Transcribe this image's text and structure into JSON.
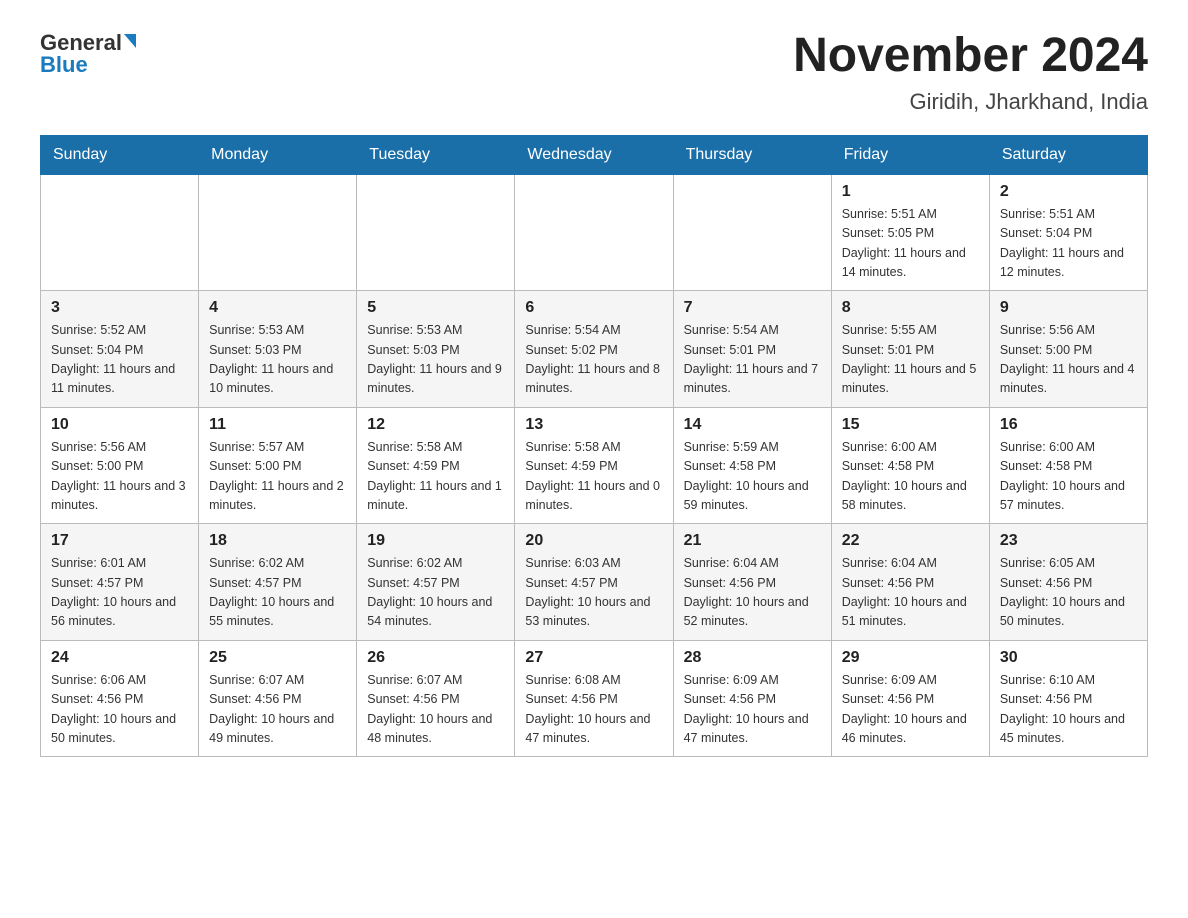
{
  "header": {
    "logo_general": "General",
    "logo_blue": "Blue",
    "title": "November 2024",
    "subtitle": "Giridih, Jharkhand, India"
  },
  "days_of_week": [
    "Sunday",
    "Monday",
    "Tuesday",
    "Wednesday",
    "Thursday",
    "Friday",
    "Saturday"
  ],
  "weeks": [
    [
      {
        "day": "",
        "sunrise": "",
        "sunset": "",
        "daylight": ""
      },
      {
        "day": "",
        "sunrise": "",
        "sunset": "",
        "daylight": ""
      },
      {
        "day": "",
        "sunrise": "",
        "sunset": "",
        "daylight": ""
      },
      {
        "day": "",
        "sunrise": "",
        "sunset": "",
        "daylight": ""
      },
      {
        "day": "",
        "sunrise": "",
        "sunset": "",
        "daylight": ""
      },
      {
        "day": "1",
        "sunrise": "Sunrise: 5:51 AM",
        "sunset": "Sunset: 5:05 PM",
        "daylight": "Daylight: 11 hours and 14 minutes."
      },
      {
        "day": "2",
        "sunrise": "Sunrise: 5:51 AM",
        "sunset": "Sunset: 5:04 PM",
        "daylight": "Daylight: 11 hours and 12 minutes."
      }
    ],
    [
      {
        "day": "3",
        "sunrise": "Sunrise: 5:52 AM",
        "sunset": "Sunset: 5:04 PM",
        "daylight": "Daylight: 11 hours and 11 minutes."
      },
      {
        "day": "4",
        "sunrise": "Sunrise: 5:53 AM",
        "sunset": "Sunset: 5:03 PM",
        "daylight": "Daylight: 11 hours and 10 minutes."
      },
      {
        "day": "5",
        "sunrise": "Sunrise: 5:53 AM",
        "sunset": "Sunset: 5:03 PM",
        "daylight": "Daylight: 11 hours and 9 minutes."
      },
      {
        "day": "6",
        "sunrise": "Sunrise: 5:54 AM",
        "sunset": "Sunset: 5:02 PM",
        "daylight": "Daylight: 11 hours and 8 minutes."
      },
      {
        "day": "7",
        "sunrise": "Sunrise: 5:54 AM",
        "sunset": "Sunset: 5:01 PM",
        "daylight": "Daylight: 11 hours and 7 minutes."
      },
      {
        "day": "8",
        "sunrise": "Sunrise: 5:55 AM",
        "sunset": "Sunset: 5:01 PM",
        "daylight": "Daylight: 11 hours and 5 minutes."
      },
      {
        "day": "9",
        "sunrise": "Sunrise: 5:56 AM",
        "sunset": "Sunset: 5:00 PM",
        "daylight": "Daylight: 11 hours and 4 minutes."
      }
    ],
    [
      {
        "day": "10",
        "sunrise": "Sunrise: 5:56 AM",
        "sunset": "Sunset: 5:00 PM",
        "daylight": "Daylight: 11 hours and 3 minutes."
      },
      {
        "day": "11",
        "sunrise": "Sunrise: 5:57 AM",
        "sunset": "Sunset: 5:00 PM",
        "daylight": "Daylight: 11 hours and 2 minutes."
      },
      {
        "day": "12",
        "sunrise": "Sunrise: 5:58 AM",
        "sunset": "Sunset: 4:59 PM",
        "daylight": "Daylight: 11 hours and 1 minute."
      },
      {
        "day": "13",
        "sunrise": "Sunrise: 5:58 AM",
        "sunset": "Sunset: 4:59 PM",
        "daylight": "Daylight: 11 hours and 0 minutes."
      },
      {
        "day": "14",
        "sunrise": "Sunrise: 5:59 AM",
        "sunset": "Sunset: 4:58 PM",
        "daylight": "Daylight: 10 hours and 59 minutes."
      },
      {
        "day": "15",
        "sunrise": "Sunrise: 6:00 AM",
        "sunset": "Sunset: 4:58 PM",
        "daylight": "Daylight: 10 hours and 58 minutes."
      },
      {
        "day": "16",
        "sunrise": "Sunrise: 6:00 AM",
        "sunset": "Sunset: 4:58 PM",
        "daylight": "Daylight: 10 hours and 57 minutes."
      }
    ],
    [
      {
        "day": "17",
        "sunrise": "Sunrise: 6:01 AM",
        "sunset": "Sunset: 4:57 PM",
        "daylight": "Daylight: 10 hours and 56 minutes."
      },
      {
        "day": "18",
        "sunrise": "Sunrise: 6:02 AM",
        "sunset": "Sunset: 4:57 PM",
        "daylight": "Daylight: 10 hours and 55 minutes."
      },
      {
        "day": "19",
        "sunrise": "Sunrise: 6:02 AM",
        "sunset": "Sunset: 4:57 PM",
        "daylight": "Daylight: 10 hours and 54 minutes."
      },
      {
        "day": "20",
        "sunrise": "Sunrise: 6:03 AM",
        "sunset": "Sunset: 4:57 PM",
        "daylight": "Daylight: 10 hours and 53 minutes."
      },
      {
        "day": "21",
        "sunrise": "Sunrise: 6:04 AM",
        "sunset": "Sunset: 4:56 PM",
        "daylight": "Daylight: 10 hours and 52 minutes."
      },
      {
        "day": "22",
        "sunrise": "Sunrise: 6:04 AM",
        "sunset": "Sunset: 4:56 PM",
        "daylight": "Daylight: 10 hours and 51 minutes."
      },
      {
        "day": "23",
        "sunrise": "Sunrise: 6:05 AM",
        "sunset": "Sunset: 4:56 PM",
        "daylight": "Daylight: 10 hours and 50 minutes."
      }
    ],
    [
      {
        "day": "24",
        "sunrise": "Sunrise: 6:06 AM",
        "sunset": "Sunset: 4:56 PM",
        "daylight": "Daylight: 10 hours and 50 minutes."
      },
      {
        "day": "25",
        "sunrise": "Sunrise: 6:07 AM",
        "sunset": "Sunset: 4:56 PM",
        "daylight": "Daylight: 10 hours and 49 minutes."
      },
      {
        "day": "26",
        "sunrise": "Sunrise: 6:07 AM",
        "sunset": "Sunset: 4:56 PM",
        "daylight": "Daylight: 10 hours and 48 minutes."
      },
      {
        "day": "27",
        "sunrise": "Sunrise: 6:08 AM",
        "sunset": "Sunset: 4:56 PM",
        "daylight": "Daylight: 10 hours and 47 minutes."
      },
      {
        "day": "28",
        "sunrise": "Sunrise: 6:09 AM",
        "sunset": "Sunset: 4:56 PM",
        "daylight": "Daylight: 10 hours and 47 minutes."
      },
      {
        "day": "29",
        "sunrise": "Sunrise: 6:09 AM",
        "sunset": "Sunset: 4:56 PM",
        "daylight": "Daylight: 10 hours and 46 minutes."
      },
      {
        "day": "30",
        "sunrise": "Sunrise: 6:10 AM",
        "sunset": "Sunset: 4:56 PM",
        "daylight": "Daylight: 10 hours and 45 minutes."
      }
    ]
  ]
}
